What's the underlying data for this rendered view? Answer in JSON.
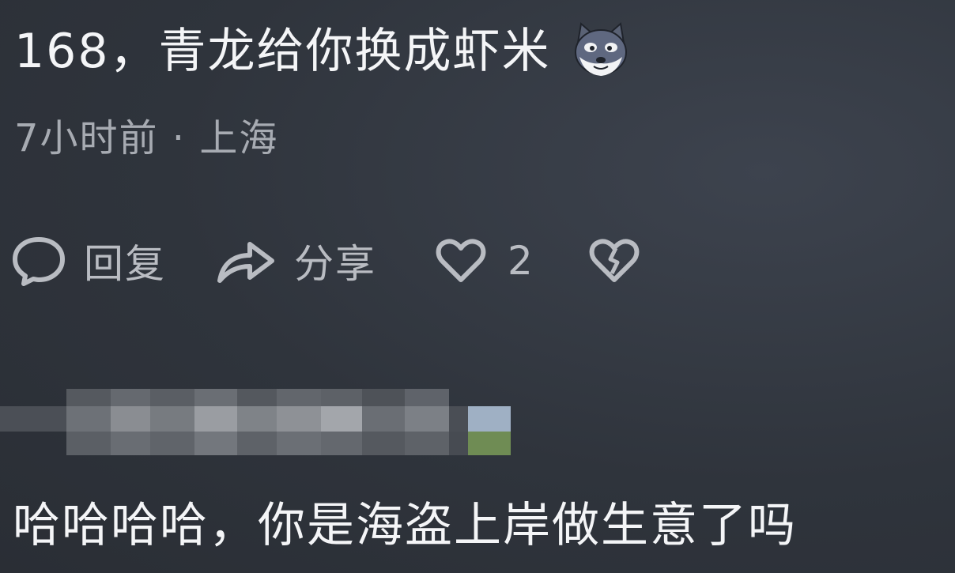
{
  "comment": {
    "text": "168，青龙给你换成虾米",
    "emoji": "doge-emoji"
  },
  "meta": {
    "text": "7小时前 · 上海"
  },
  "actions": {
    "reply_label": "回复",
    "share_label": "分享",
    "like_count": "2",
    "icons": [
      "comment-bubble-icon",
      "share-arrow-icon",
      "heart-icon",
      "broken-heart-icon"
    ]
  },
  "reply": {
    "username": "[pixelated username]",
    "text": "哈哈哈哈，你是海盗上岸做生意了吗"
  },
  "colors": {
    "background": "#2f343c",
    "primary_text": "#f4f5f7",
    "secondary_text": "#a7abb2",
    "icon": "#b9bcc2"
  }
}
